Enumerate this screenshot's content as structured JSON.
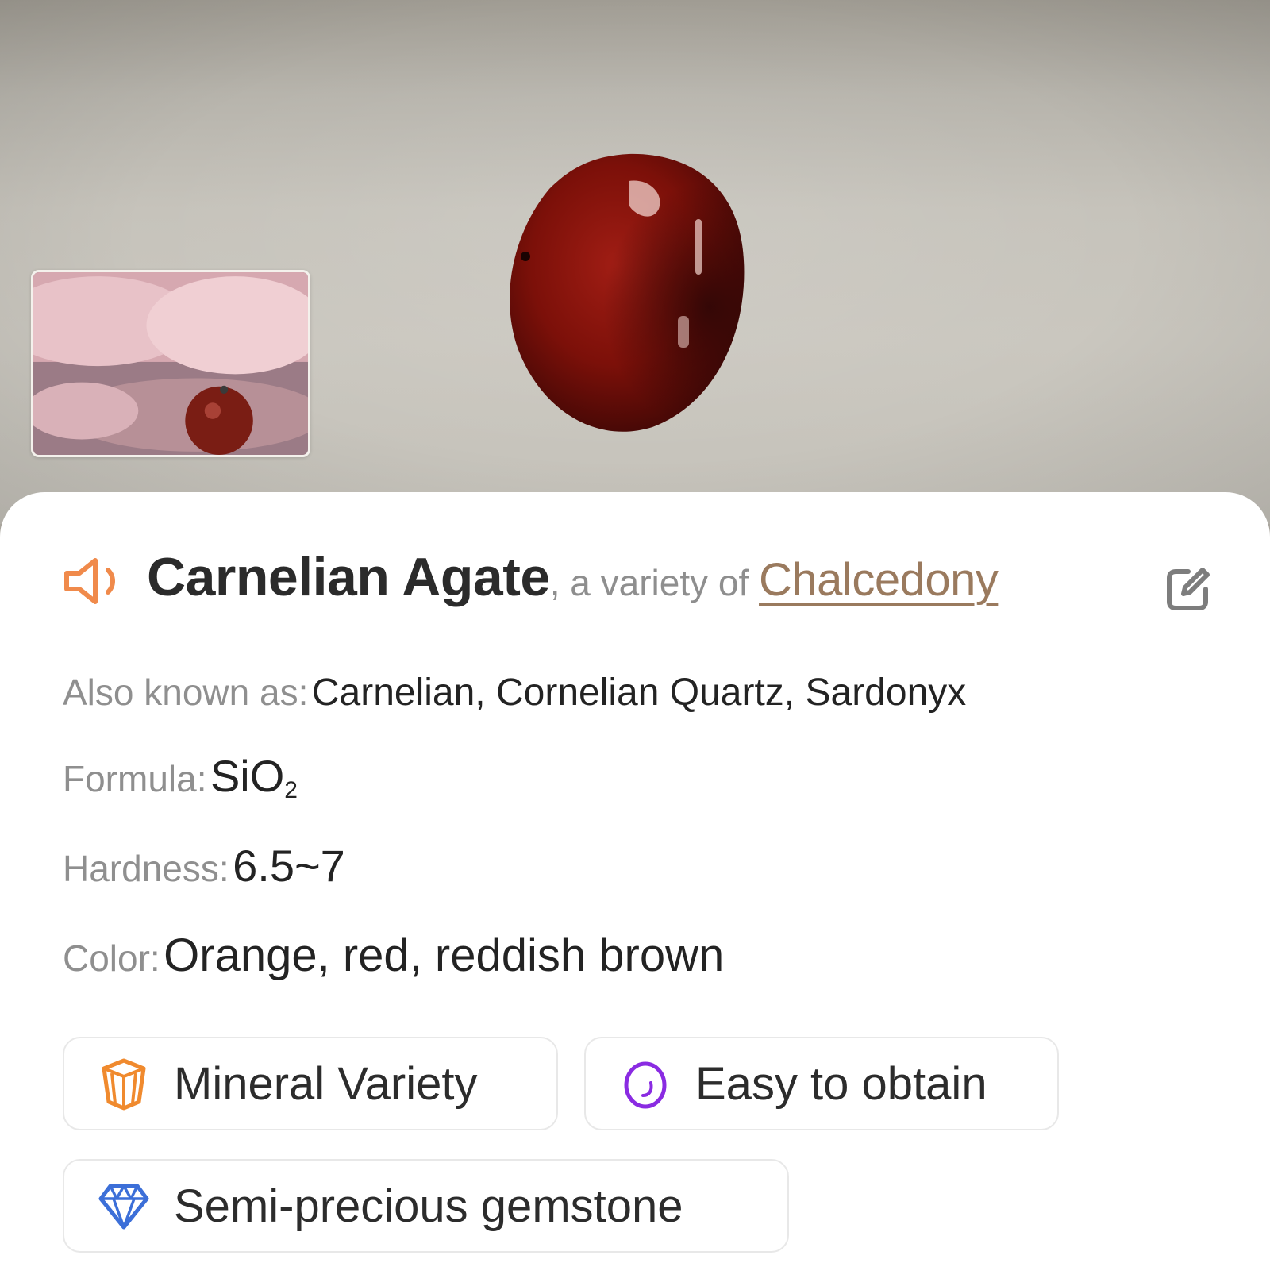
{
  "header": {
    "stone_image": "carnelian-stone-photo",
    "thumbnail_image": "user-photo-thumbnail"
  },
  "result": {
    "name": "Carnelian Agate",
    "variety_prefix": ", a variety of ",
    "variety_link": "Chalcedony",
    "icons": {
      "speaker": "speaker-icon",
      "edit": "edit-icon"
    },
    "accent_color": "#f08a4b",
    "link_color": "#9a7a5e"
  },
  "properties": {
    "aka_label": "Also known as:",
    "aka_value": "Carnelian, Cornelian Quartz, Sardonyx",
    "formula_label": "Formula:",
    "formula_main": "SiO",
    "formula_sub": "2",
    "hardness_label": "Hardness:",
    "hardness_value": "6.5~7",
    "color_label": "Color:",
    "color_value": "Orange, red, reddish brown"
  },
  "tags": [
    {
      "label": "Mineral Variety",
      "icon": "crystal-icon",
      "color": "#f08a2e"
    },
    {
      "label": "Easy to obtain",
      "icon": "rarity-icon",
      "color": "#8a2be2"
    },
    {
      "label": "Semi-precious gemstone",
      "icon": "diamond-icon",
      "color": "#3c6fd8"
    }
  ]
}
